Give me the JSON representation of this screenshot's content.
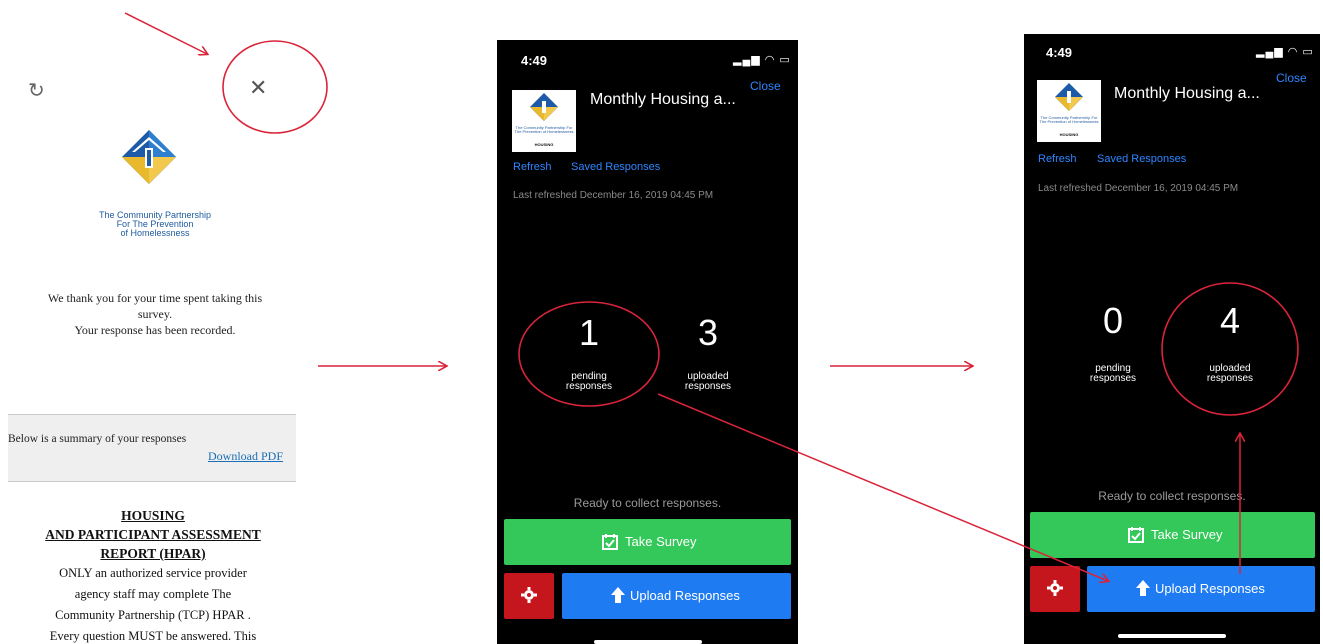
{
  "panel1": {
    "org_name_lines": [
      "The Community Partnership",
      "For The Prevention",
      "of Homelessness"
    ],
    "thanks_lines": [
      "We thank you for your time spent taking this",
      "survey.",
      "Your response has been recorded."
    ],
    "summary_text": "Below is a summary of your responses",
    "download_pdf": "Download PDF",
    "doc_heading_lines": [
      "HOUSING",
      "AND PARTICIPANT ASSESSMENT",
      "REPORT (HPAR)"
    ],
    "doc_body_lines": [
      "ONLY an authorized service provider",
      "agency staff may complete The",
      "Community Partnership (TCP) HPAR .",
      "Every question MUST be answered.  This"
    ]
  },
  "phone_left": {
    "time": "4:49",
    "status": "▂▄▆ ◠ ▭",
    "close": "Close",
    "title": "Monthly Housing a...",
    "logo_text": "The Community Partnership For The Prevention of Homelessness",
    "logo_footer": "HOUSING",
    "refresh": "Refresh",
    "saved": "Saved Responses",
    "last_refreshed": "Last refreshed December 16, 2019 04:45 PM",
    "pending_count": "1",
    "pending_label_lines": [
      "pending",
      "responses"
    ],
    "uploaded_count": "3",
    "uploaded_label_lines": [
      "uploaded",
      "responses"
    ],
    "ready": "Ready to collect responses.",
    "take_survey": "Take Survey",
    "upload": "Upload Responses"
  },
  "phone_right": {
    "time": "4:49",
    "status": "▂▄▆ ◠ ▭",
    "close": "Close",
    "title": "Monthly Housing a...",
    "logo_text": "The Community Partnership For The Prevention of Homelessness",
    "logo_footer": "HOUSING",
    "refresh": "Refresh",
    "saved": "Saved Responses",
    "last_refreshed": "Last refreshed December 16, 2019 04:45 PM",
    "pending_count": "0",
    "pending_label_lines": [
      "pending",
      "responses"
    ],
    "uploaded_count": "4",
    "uploaded_label_lines": [
      "uploaded",
      "responses"
    ],
    "ready": "Ready to collect responses.",
    "take_survey": "Take Survey",
    "upload": "Upload Responses"
  },
  "icons": {
    "reload": "reload-icon",
    "close": "close-icon",
    "calendar": "calendar-check-icon",
    "upload": "upload-arrow-icon",
    "settings": "gear-icon"
  },
  "colors": {
    "annotation": "#d9243a",
    "green_button": "#34c759",
    "blue_button": "#1e7bf2",
    "red_button": "#c4161c",
    "link_blue": "#2f86ff"
  }
}
